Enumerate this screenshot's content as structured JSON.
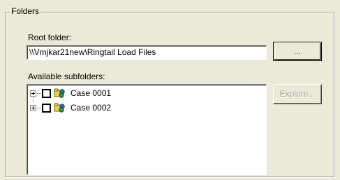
{
  "group": {
    "title": "Folders"
  },
  "root_folder": {
    "label": "Root folder:",
    "value": "\\\\Vmjkar21new\\Ringtail Load Files",
    "browse_label": "..."
  },
  "subfolders": {
    "label": "Available subfolders:",
    "explore_label": "Explore...",
    "items": [
      {
        "label": "Case 0001",
        "checked": false,
        "icon": "folder-icon"
      },
      {
        "label": "Case 0002",
        "checked": false,
        "icon": "folder-icon"
      }
    ]
  }
}
